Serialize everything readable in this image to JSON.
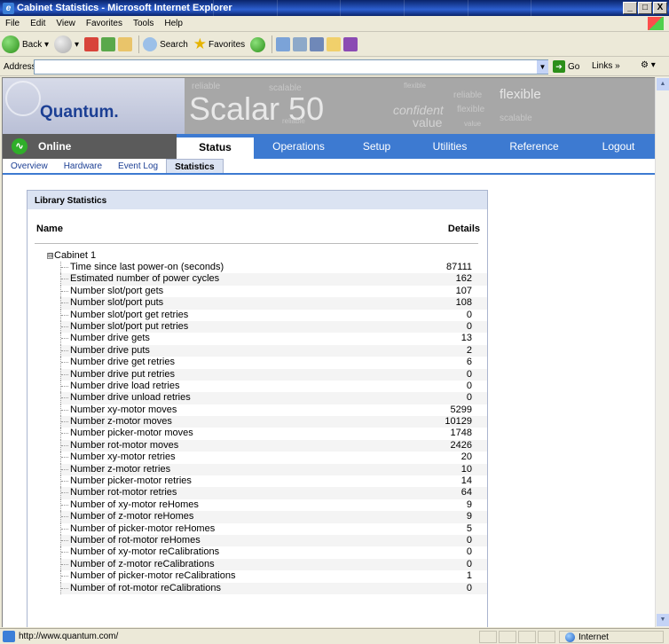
{
  "window": {
    "title": "Cabinet Statistics - Microsoft Internet Explorer",
    "controls": [
      "_",
      "□",
      "X"
    ]
  },
  "menu": [
    "File",
    "Edit",
    "View",
    "Favorites",
    "Tools",
    "Help"
  ],
  "toolbar": {
    "back": "Back",
    "search": "Search",
    "favorites": "Favorites"
  },
  "address": {
    "label": "Address",
    "value": "",
    "go": "Go",
    "links": "Links »"
  },
  "banner": {
    "brand": "Quantum.",
    "product": "Scalar 50",
    "watermarks": [
      "reliable",
      "scalable",
      "confident",
      "flexible",
      "value",
      "reliable",
      "flexible",
      "scalable",
      "value",
      "flexible",
      "reliable"
    ]
  },
  "status": {
    "label": "Online"
  },
  "nav": {
    "tabs": [
      {
        "label": "Status",
        "active": true
      },
      {
        "label": "Operations",
        "active": false
      },
      {
        "label": "Setup",
        "active": false
      },
      {
        "label": "Utilities",
        "active": false
      },
      {
        "label": "Reference",
        "active": false
      },
      {
        "label": "Logout",
        "active": false
      }
    ]
  },
  "subnav": {
    "tabs": [
      {
        "label": "Overview",
        "active": false
      },
      {
        "label": "Hardware",
        "active": false
      },
      {
        "label": "Event Log",
        "active": false
      },
      {
        "label": "Statistics",
        "active": true
      }
    ]
  },
  "panel": {
    "title": "Library Statistics",
    "col_name": "Name",
    "col_details": "Details",
    "cabinet": {
      "toggle": "⊟",
      "label": "Cabinet 1"
    },
    "rows": [
      {
        "name": "Time since last power-on (seconds)",
        "value": "87111"
      },
      {
        "name": "Estimated number of power cycles",
        "value": "162"
      },
      {
        "name": "Number slot/port gets",
        "value": "107"
      },
      {
        "name": "Number slot/port puts",
        "value": "108"
      },
      {
        "name": "Number slot/port get retries",
        "value": "0"
      },
      {
        "name": "Number slot/port put retries",
        "value": "0"
      },
      {
        "name": "Number drive gets",
        "value": "13"
      },
      {
        "name": "Number drive puts",
        "value": "2"
      },
      {
        "name": "Number drive get retries",
        "value": "6"
      },
      {
        "name": "Number drive put retries",
        "value": "0"
      },
      {
        "name": "Number drive load retries",
        "value": "0"
      },
      {
        "name": "Number drive unload retries",
        "value": "0"
      },
      {
        "name": "Number xy-motor moves",
        "value": "5299"
      },
      {
        "name": "Number z-motor moves",
        "value": "10129"
      },
      {
        "name": "Number picker-motor moves",
        "value": "1748"
      },
      {
        "name": "Number rot-motor moves",
        "value": "2426"
      },
      {
        "name": "Number xy-motor retries",
        "value": "20"
      },
      {
        "name": "Number z-motor retries",
        "value": "10"
      },
      {
        "name": "Number picker-motor retries",
        "value": "14"
      },
      {
        "name": "Number rot-motor retries",
        "value": "64"
      },
      {
        "name": "Number of xy-motor reHomes",
        "value": "9"
      },
      {
        "name": "Number of z-motor reHomes",
        "value": "9"
      },
      {
        "name": "Number of picker-motor reHomes",
        "value": "5"
      },
      {
        "name": "Number of rot-motor reHomes",
        "value": "0"
      },
      {
        "name": "Number of xy-motor reCalibrations",
        "value": "0"
      },
      {
        "name": "Number of z-motor reCalibrations",
        "value": "0"
      },
      {
        "name": "Number of picker-motor reCalibrations",
        "value": "1"
      },
      {
        "name": "Number of rot-motor reCalibrations",
        "value": "0"
      }
    ]
  },
  "statusbar": {
    "url": "http://www.quantum.com/",
    "zone": "Internet"
  }
}
